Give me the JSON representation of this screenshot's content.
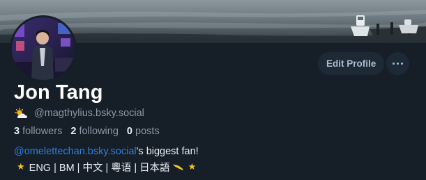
{
  "profile": {
    "display_name": "Jon Tang",
    "handle": "@magthylius.bsky.social",
    "handle_icon": "sun-behind-cloud-icon",
    "stats": {
      "followers_count": "3",
      "followers_label": "followers",
      "following_count": "2",
      "following_label": "following",
      "posts_count": "0",
      "posts_label": "posts"
    },
    "bio": {
      "mention": "@omelettechan.bsky.social",
      "line1_rest": "'s biggest fan!",
      "languages": "ENG | BM | 中文 | 粵语 | 日本語",
      "star_icon": "star-icon",
      "banana_icon": "banana-icon"
    }
  },
  "actions": {
    "edit_profile_label": "Edit Profile",
    "more_icon": "ellipsis-icon"
  },
  "colors": {
    "background": "#161e27",
    "button_bg": "#1e2936",
    "link": "#2f7fe0",
    "muted_text": "#8b98a6",
    "primary_text": "#ffffff"
  }
}
